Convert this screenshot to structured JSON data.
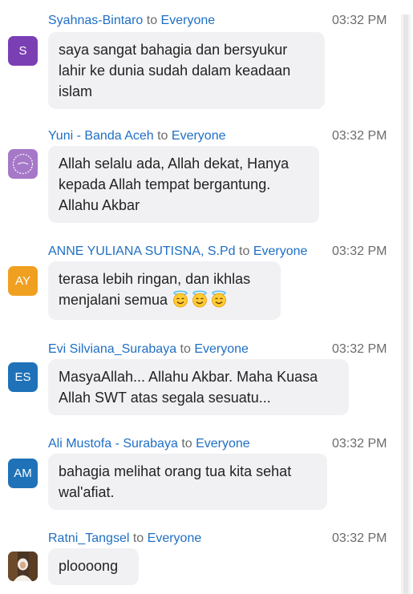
{
  "chat": {
    "to_word": "to",
    "messages": [
      {
        "sender": "Syahnas-Bintaro",
        "recipient": "Everyone",
        "time": "03:32 PM",
        "avatar": {
          "initials": "S",
          "color": "#7b3fb4",
          "kind": "initials"
        },
        "lines": [
          "saya sangat bahagia dan bersyukur",
          "lahir ke dunia sudah dalam keadaan",
          "islam"
        ]
      },
      {
        "sender": "Yuni - Banda Aceh",
        "recipient": "Everyone",
        "time": "03:32 PM",
        "avatar": {
          "initials": "",
          "color": "#a678c8",
          "kind": "picture"
        },
        "lines": [
          "Allah selalu ada, Allah dekat, Hanya",
          "kepada Allah tempat bergantung.",
          "Allahu Akbar"
        ]
      },
      {
        "sender": "ANNE YULIANA SUTISNA, S.Pd",
        "recipient": "Everyone",
        "time": "03:32 PM",
        "avatar": {
          "initials": "AY",
          "color": "#f0a020",
          "kind": "initials"
        },
        "lines": [
          "terasa lebih ringan, dan ikhlas",
          "menjalani semua"
        ],
        "emoji_count": 3,
        "emoji_icon": "smiling-face-with-halo-icon"
      },
      {
        "sender": "Evi Silviana_Surabaya",
        "recipient": "Everyone",
        "time": "03:32 PM",
        "avatar": {
          "initials": "ES",
          "color": "#1f72b8",
          "kind": "initials"
        },
        "lines": [
          "MasyaAllah... Allahu Akbar. Maha Kuasa",
          "Allah SWT atas segala sesuatu..."
        ]
      },
      {
        "sender": "Ali Mustofa - Surabaya",
        "recipient": "Everyone",
        "time": "03:32 PM",
        "avatar": {
          "initials": "AM",
          "color": "#1f72b8",
          "kind": "initials"
        },
        "lines": [
          "bahagia melihat orang tua kita sehat",
          "wal'afiat."
        ]
      },
      {
        "sender": "Ratni_Tangsel",
        "recipient": "Everyone",
        "time": "03:32 PM",
        "avatar": {
          "initials": "",
          "color": "#3a2a1e",
          "kind": "photo"
        },
        "lines": [
          "ploooong"
        ]
      }
    ]
  }
}
